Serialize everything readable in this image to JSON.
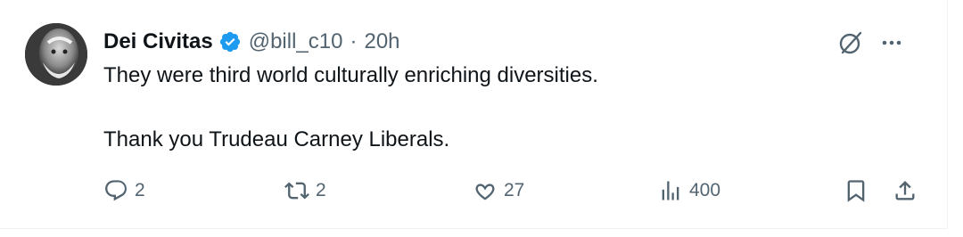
{
  "tweet": {
    "author_name": "Dei Civitas",
    "handle": "@bill_c10",
    "separator": "·",
    "time": "20h",
    "paragraphs": [
      "They were third world culturally enriching diversities.",
      "Thank you Trudeau Carney Liberals."
    ],
    "verified": true
  },
  "icons": {
    "grok": "grok-icon",
    "more": "more-icon",
    "reply": "reply-icon",
    "retweet": "retweet-icon",
    "like": "like-icon",
    "views": "views-icon",
    "bookmark": "bookmark-icon",
    "share": "share-icon"
  },
  "actions": {
    "reply_count": "2",
    "retweet_count": "2",
    "like_count": "27",
    "view_count": "400"
  },
  "colors": {
    "text": "#0f1419",
    "muted": "#536471",
    "verified_blue": "#1d9bf0"
  }
}
